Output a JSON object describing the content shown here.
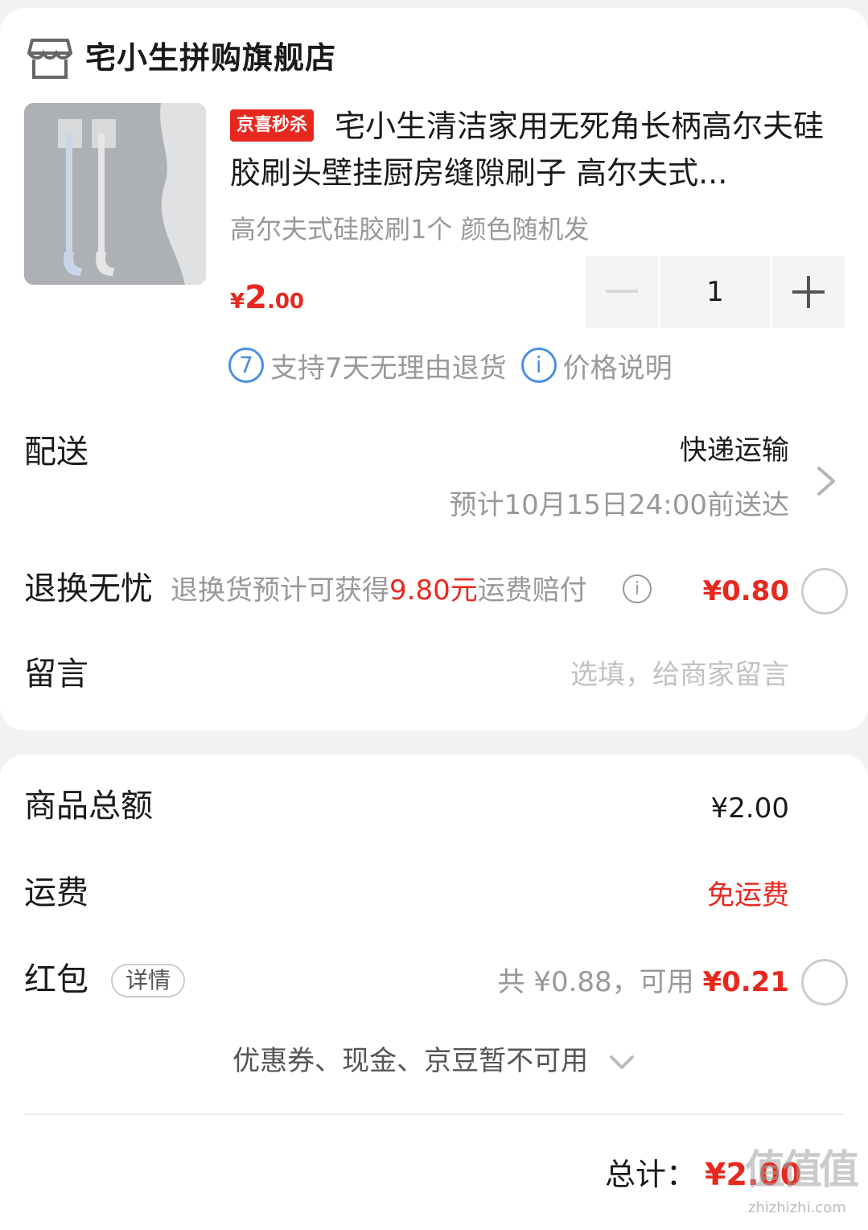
{
  "shop": {
    "name": "宅小生拼购旗舰店",
    "icon": "store-icon"
  },
  "product": {
    "promo_tag": "京喜秒杀",
    "title": "宅小生清洁家用无死角长柄高尔夫硅胶刷头壁挂厨房缝隙刷子 高尔夫式...",
    "spec": "高尔夫式硅胶刷1个 颜色随机发",
    "price_symbol": "¥",
    "price_int": "2",
    "price_dec": ".00",
    "quantity": "1",
    "badges": [
      {
        "icon_text": "7",
        "label": "支持7天无理由退货"
      },
      {
        "icon_text": "i",
        "label": "价格说明"
      }
    ]
  },
  "delivery": {
    "label": "配送",
    "method": "快递运输",
    "eta": "预计10月15日24:00前送达"
  },
  "return_insurance": {
    "label": "退换无忧",
    "desc_prefix": "退换货预计可获得",
    "desc_amount": "9.80元",
    "desc_suffix": "运费赔付",
    "price": "¥0.80"
  },
  "message": {
    "label": "留言",
    "placeholder": "选填，给商家留言"
  },
  "summary": {
    "goods_total_label": "商品总额",
    "goods_total_value": "¥2.00",
    "shipping_label": "运费",
    "shipping_value": "免运费",
    "redpacket_label": "红包",
    "redpacket_detail": "详情",
    "redpacket_total": "共 ¥0.88，可用 ",
    "redpacket_usable": "¥0.21",
    "coupon_note": "优惠券、现金、京豆暂不可用"
  },
  "footer": {
    "total_label": "总计：",
    "total_value": "¥2.00",
    "watermark": "值值值",
    "watermark_url": "zhizhizhi.com"
  },
  "colors": {
    "accent_red": "#e8281e",
    "info_blue": "#4a90e2",
    "muted_gray": "#999999"
  }
}
